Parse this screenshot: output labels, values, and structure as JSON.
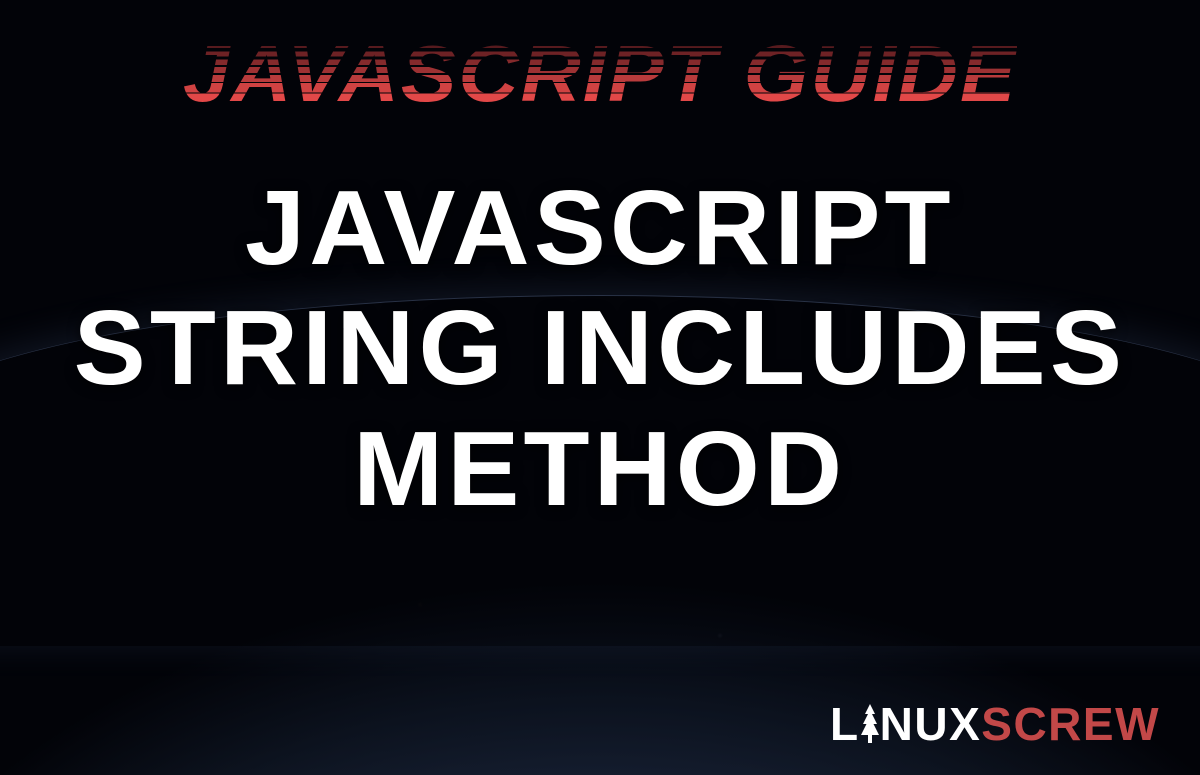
{
  "header": {
    "title": "JAVASCRIPT GUIDE"
  },
  "main": {
    "line1": "JAVASCRIPT",
    "line2": "STRING INCLUDES",
    "line3": "METHOD"
  },
  "brand": {
    "part1": "L",
    "part2": "NUX",
    "part3": "SCREW"
  }
}
